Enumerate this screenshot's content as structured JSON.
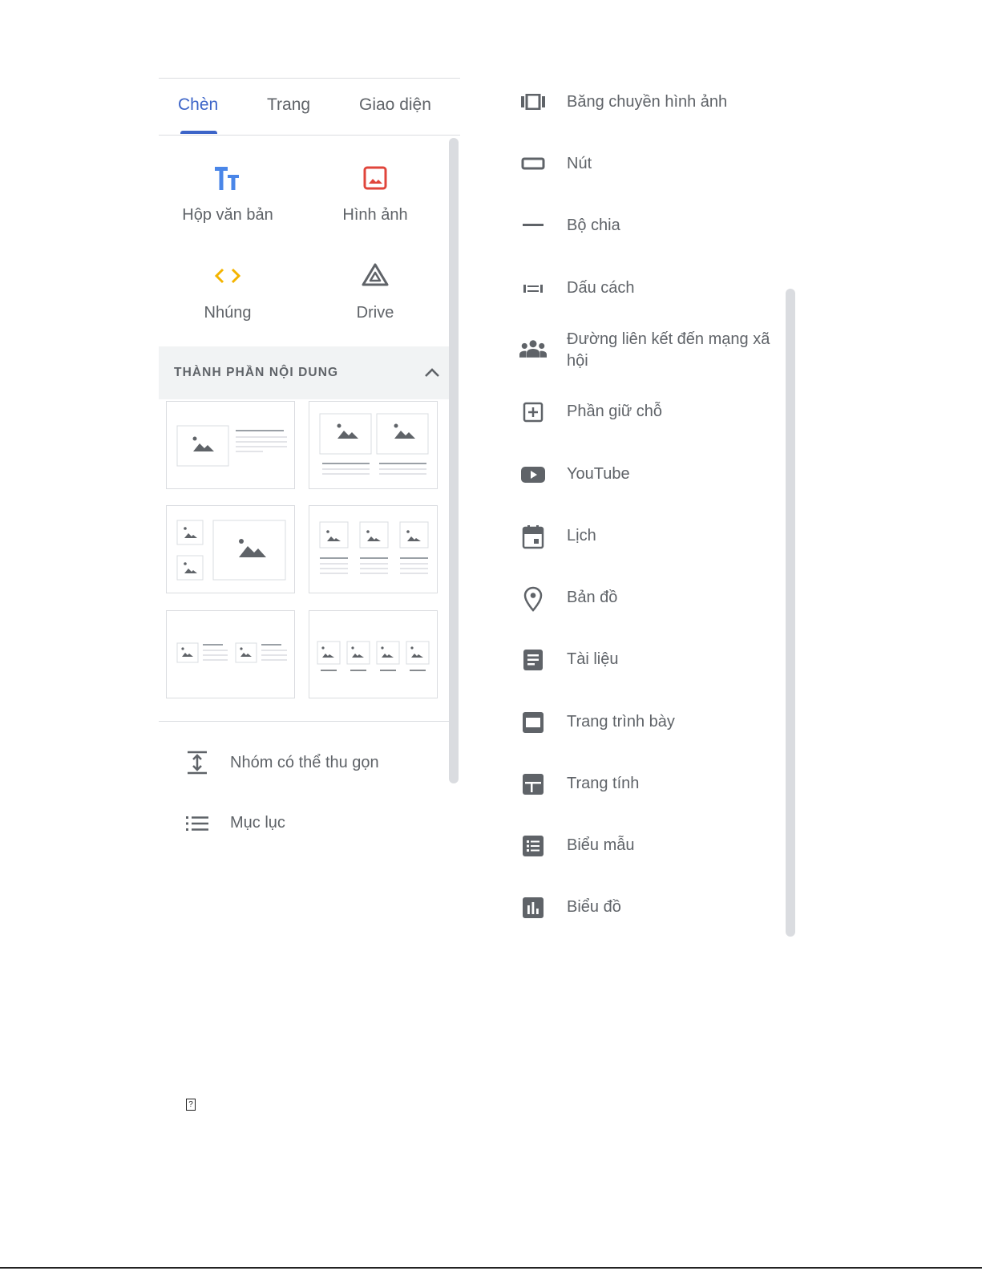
{
  "tabs": [
    {
      "label": "Chèn"
    },
    {
      "label": "Trang"
    },
    {
      "label": "Giao diện"
    }
  ],
  "insert_tiles": [
    {
      "label": "Hộp văn bản",
      "icon": "text-box-icon",
      "color": "#4a86e8"
    },
    {
      "label": "Hình ảnh",
      "icon": "image-icon",
      "color": "#e0453b"
    },
    {
      "label": "Nhúng",
      "icon": "embed-icon",
      "color": "#f4b400"
    },
    {
      "label": "Drive",
      "icon": "drive-icon",
      "color": "#5f6368"
    }
  ],
  "content_blocks": {
    "title": "THÀNH PHẦN NỘI DUNG",
    "collapse_icon": "chevron-up-icon"
  },
  "left_list": [
    {
      "label": "Nhóm có thể thu gọn",
      "icon": "collapsible-group-icon"
    },
    {
      "label": "Mục lục",
      "icon": "table-of-contents-icon"
    }
  ],
  "right_list": [
    {
      "label": "Băng chuyền hình ảnh",
      "icon": "image-carousel-icon"
    },
    {
      "label": "Nút",
      "icon": "button-icon"
    },
    {
      "label": "Bộ chia",
      "icon": "divider-icon"
    },
    {
      "label": "Dấu cách",
      "icon": "spacer-icon"
    },
    {
      "label": "Đường liên kết đến mạng xã hội",
      "icon": "social-links-icon"
    },
    {
      "label": "Phần giữ chỗ",
      "icon": "placeholder-icon"
    },
    {
      "label": "YouTube",
      "icon": "youtube-icon"
    },
    {
      "label": "Lịch",
      "icon": "calendar-icon"
    },
    {
      "label": "Bản đồ",
      "icon": "map-pin-icon"
    },
    {
      "label": "Tài liệu",
      "icon": "docs-icon"
    },
    {
      "label": "Trang trình bày",
      "icon": "slides-icon"
    },
    {
      "label": "Trang tính",
      "icon": "sheets-icon"
    },
    {
      "label": "Biểu mẫu",
      "icon": "forms-icon"
    },
    {
      "label": "Biểu đồ",
      "icon": "charts-icon"
    }
  ],
  "colors": {
    "accent": "#3c64c8",
    "text": "#5f6368",
    "rule": "#dadce0",
    "section_bg": "#f1f3f4"
  }
}
